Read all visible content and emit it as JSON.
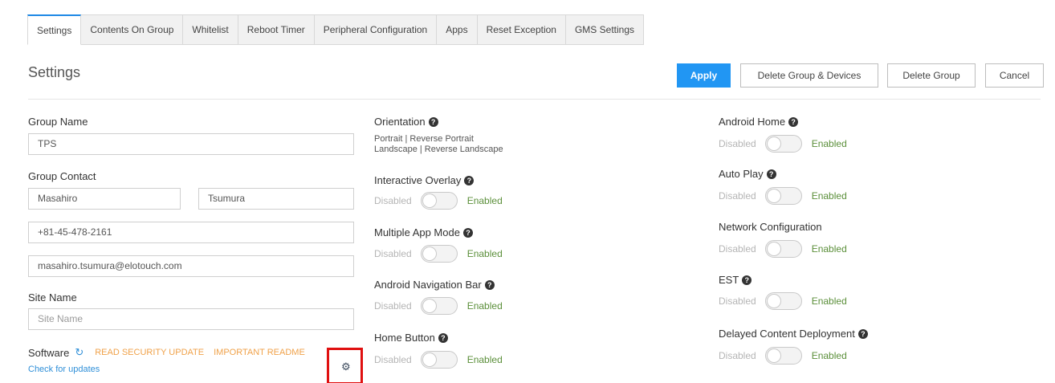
{
  "tabs": [
    {
      "label": "Settings",
      "active": true
    },
    {
      "label": "Contents On Group",
      "active": false
    },
    {
      "label": "Whitelist",
      "active": false
    },
    {
      "label": "Reboot Timer",
      "active": false
    },
    {
      "label": "Peripheral Configuration",
      "active": false
    },
    {
      "label": "Apps",
      "active": false
    },
    {
      "label": "Reset Exception",
      "active": false
    },
    {
      "label": "GMS Settings",
      "active": false
    }
  ],
  "header": {
    "title": "Settings",
    "apply_label": "Apply",
    "delete_group_devices_label": "Delete Group & Devices",
    "delete_group_label": "Delete Group",
    "cancel_label": "Cancel"
  },
  "group": {
    "name_label": "Group Name",
    "name_value": "TPS",
    "contact_label": "Group Contact",
    "first_name": "Masahiro",
    "last_name": "Tsumura",
    "phone": "+81-45-478-2161",
    "email": "masahiro.tsumura@elotouch.com",
    "site_label": "Site Name",
    "site_placeholder": "Site Name"
  },
  "software": {
    "label": "Software",
    "security_update": "READ SECURITY UPDATE",
    "readme": "IMPORTANT README",
    "check_updates": "Check for updates"
  },
  "orientation": {
    "label": "Orientation",
    "line1": "Portrait |  Reverse Portrait",
    "line2": "Landscape |  Reverse Landscape"
  },
  "toggle_text": {
    "disabled": "Disabled",
    "enabled": "Enabled"
  },
  "middle_toggles": [
    {
      "label": "Interactive Overlay",
      "help": true
    },
    {
      "label": "Multiple App Mode",
      "help": true
    },
    {
      "label": "Android Navigation Bar",
      "help": true
    },
    {
      "label": "Home Button",
      "help": true
    }
  ],
  "right_toggles": [
    {
      "label": "Android Home",
      "help": true
    },
    {
      "label": "Auto Play",
      "help": true
    },
    {
      "label": "Network Configuration",
      "help": false
    },
    {
      "label": "EST",
      "help": true
    },
    {
      "label": "Delayed Content Deployment",
      "help": true
    }
  ],
  "colors": {
    "accent": "#2196f3",
    "enabled_text": "#5b8f3a",
    "link_orange": "#f0a24a",
    "highlight": "#e01010"
  },
  "icons": {
    "help": "question-circle-icon",
    "refresh": "refresh-icon",
    "gear": "gear-icon"
  }
}
